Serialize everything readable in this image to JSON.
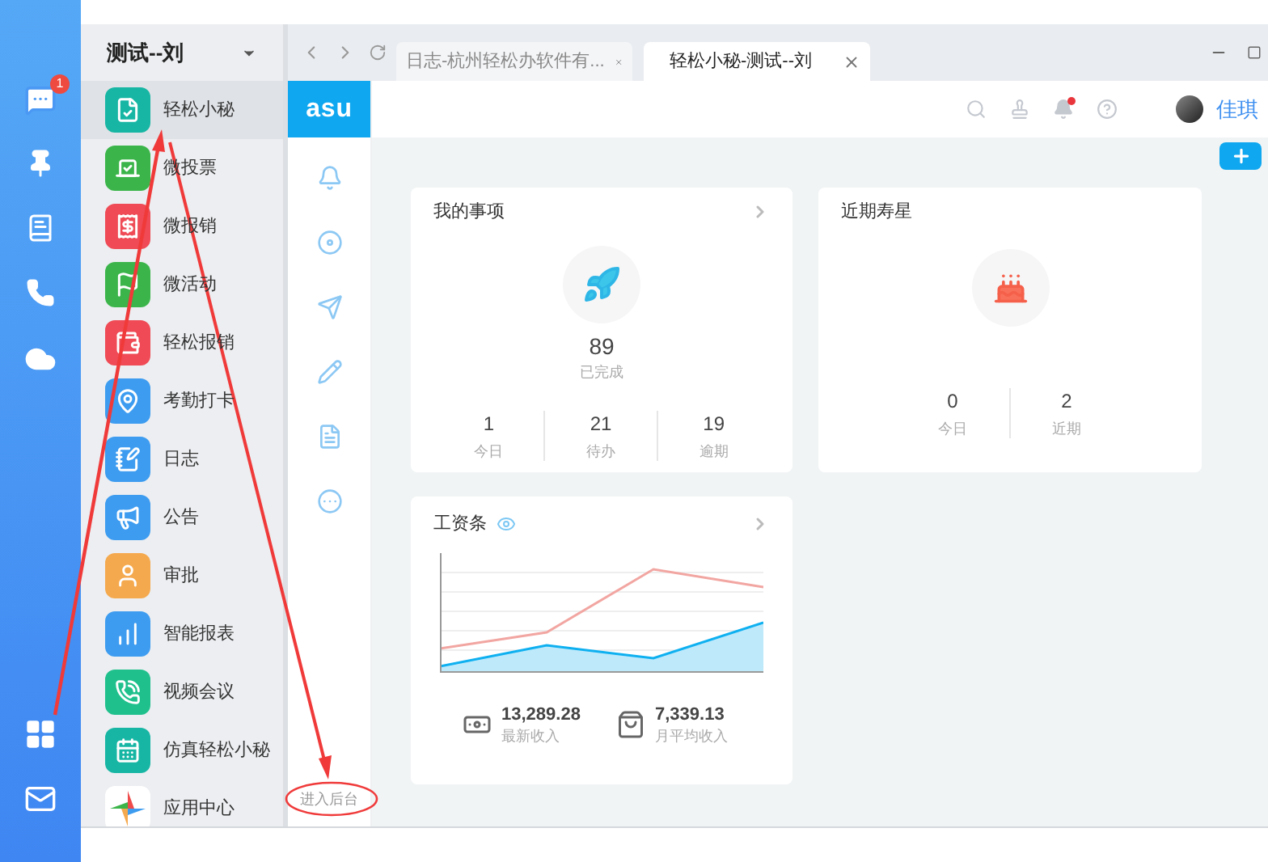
{
  "rail": {
    "chat_badge": "1"
  },
  "app_panel": {
    "title": "测试--刘",
    "items": [
      {
        "label": "轻松小秘",
        "color": "#17b6a4",
        "selected": true
      },
      {
        "label": "微投票",
        "color": "#3bb54a",
        "selected": false
      },
      {
        "label": "微报销",
        "color": "#ef4a55",
        "selected": false
      },
      {
        "label": "微活动",
        "color": "#3bb54a",
        "selected": false
      },
      {
        "label": "轻松报销",
        "color": "#ef4a55",
        "selected": false
      },
      {
        "label": "考勤打卡",
        "color": "#3d9cf0",
        "selected": false
      },
      {
        "label": "日志",
        "color": "#3d9cf0",
        "selected": false
      },
      {
        "label": "公告",
        "color": "#3d9cf0",
        "selected": false
      },
      {
        "label": "审批",
        "color": "#f5a94e",
        "selected": false
      },
      {
        "label": "智能报表",
        "color": "#3d9cf0",
        "selected": false
      },
      {
        "label": "视频会议",
        "color": "#1fc08c",
        "selected": false
      },
      {
        "label": "仿真轻松小秘",
        "color": "#17b6a4",
        "selected": false
      },
      {
        "label": "应用中心",
        "color": "#ffffff",
        "selected": false
      }
    ]
  },
  "browser": {
    "tabs": [
      {
        "label": "日志-杭州轻松办软件有...",
        "selected": false
      },
      {
        "label": "轻松小秘-测试--刘",
        "selected": true
      }
    ]
  },
  "side_menu": {
    "logo": "asu",
    "footer_link": "进入后台"
  },
  "header": {
    "has_unread": true,
    "user": "佳琪"
  },
  "todo_card": {
    "title": "我的事项",
    "total": "89",
    "total_label": "已完成",
    "stats": [
      {
        "value": "1",
        "label": "今日"
      },
      {
        "value": "21",
        "label": "待办"
      },
      {
        "value": "19",
        "label": "逾期"
      }
    ]
  },
  "birthday_card": {
    "title": "近期寿星",
    "stats": [
      {
        "value": "0",
        "label": "今日"
      },
      {
        "value": "2",
        "label": "近期"
      }
    ]
  },
  "salary_card": {
    "title": "工资条",
    "figures": [
      {
        "value": "13,289.28",
        "label": "最新收入"
      },
      {
        "value": "7,339.13",
        "label": "月平均收入"
      }
    ]
  }
}
